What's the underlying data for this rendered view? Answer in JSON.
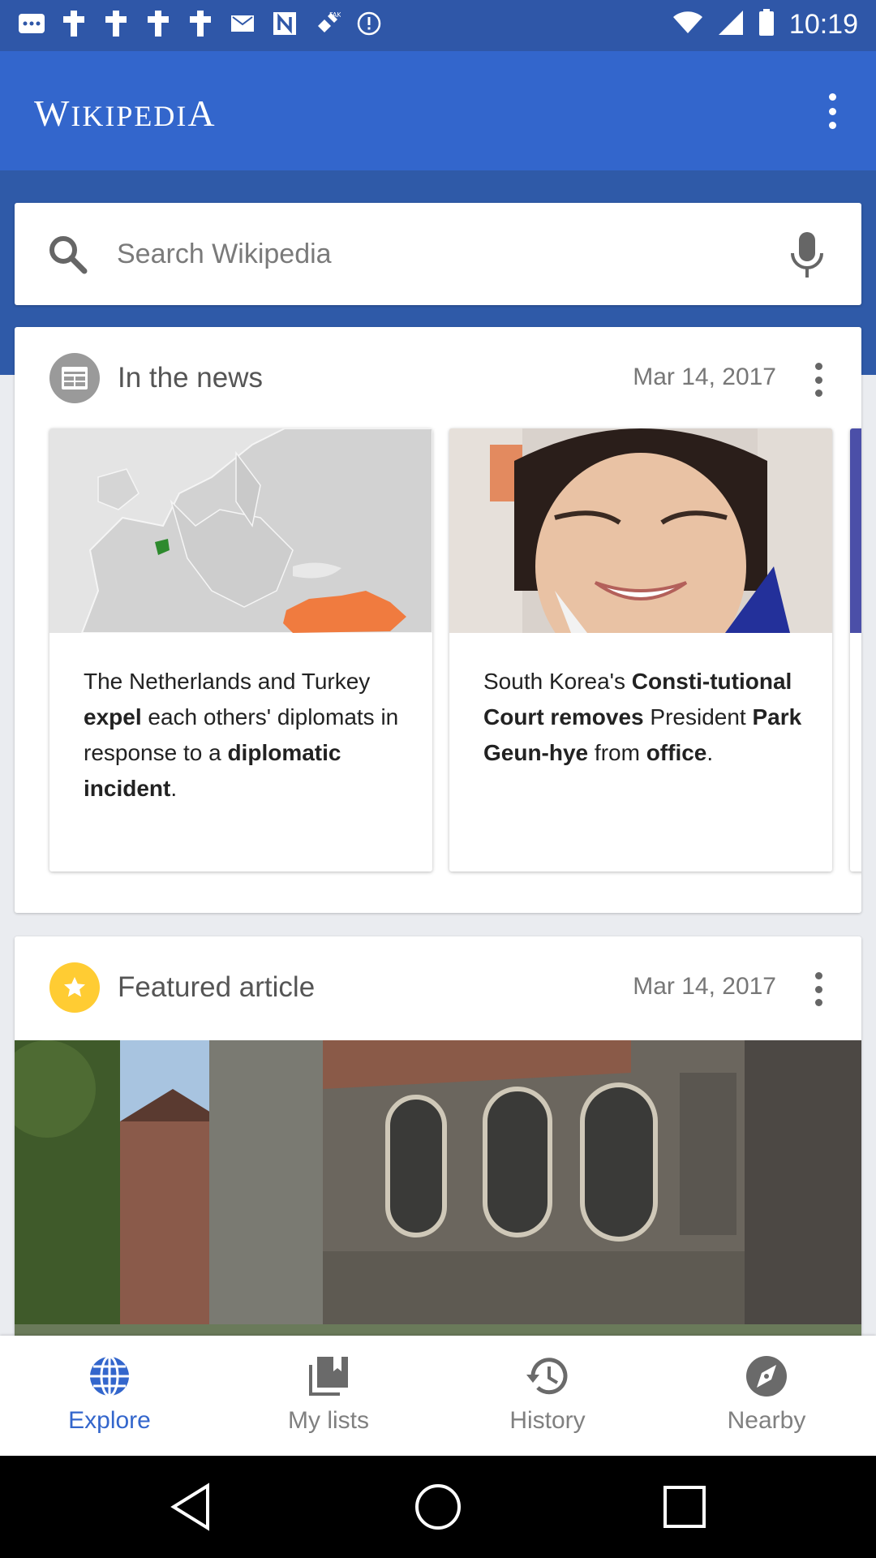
{
  "status_bar": {
    "time": "10:19"
  },
  "app_bar": {
    "logo": "Wikipedia"
  },
  "search": {
    "placeholder": "Search Wikipedia"
  },
  "news_card": {
    "title": "In the news",
    "date": "Mar 14, 2017",
    "items": [
      {
        "parts": [
          {
            "text": "The Netherlands and Turkey ",
            "bold": false
          },
          {
            "text": "expel",
            "bold": true
          },
          {
            "text": " each others' diplomats in response to a ",
            "bold": false
          },
          {
            "text": "diplomatic incident",
            "bold": true
          },
          {
            "text": ".",
            "bold": false
          }
        ]
      },
      {
        "parts": [
          {
            "text": "South Korea's ",
            "bold": false
          },
          {
            "text": "Consti-tutional Court removes",
            "bold": true
          },
          {
            "text": " President ",
            "bold": false
          },
          {
            "text": "Park Geun-hye",
            "bold": true
          },
          {
            "text": " from ",
            "bold": false
          },
          {
            "text": "office",
            "bold": true
          },
          {
            "text": ".",
            "bold": false
          }
        ]
      }
    ]
  },
  "featured_card": {
    "title": "Featured article",
    "date": "Mar 14, 2017"
  },
  "bottom_nav": {
    "items": [
      {
        "label": "Explore",
        "icon": "globe-icon",
        "active": true
      },
      {
        "label": "My lists",
        "icon": "lists-icon",
        "active": false
      },
      {
        "label": "History",
        "icon": "history-icon",
        "active": false
      },
      {
        "label": "Nearby",
        "icon": "compass-icon",
        "active": false
      }
    ]
  },
  "colors": {
    "app_bar": "#3366cc",
    "active_nav": "#3366cc",
    "featured_star": "#ffcc33"
  }
}
